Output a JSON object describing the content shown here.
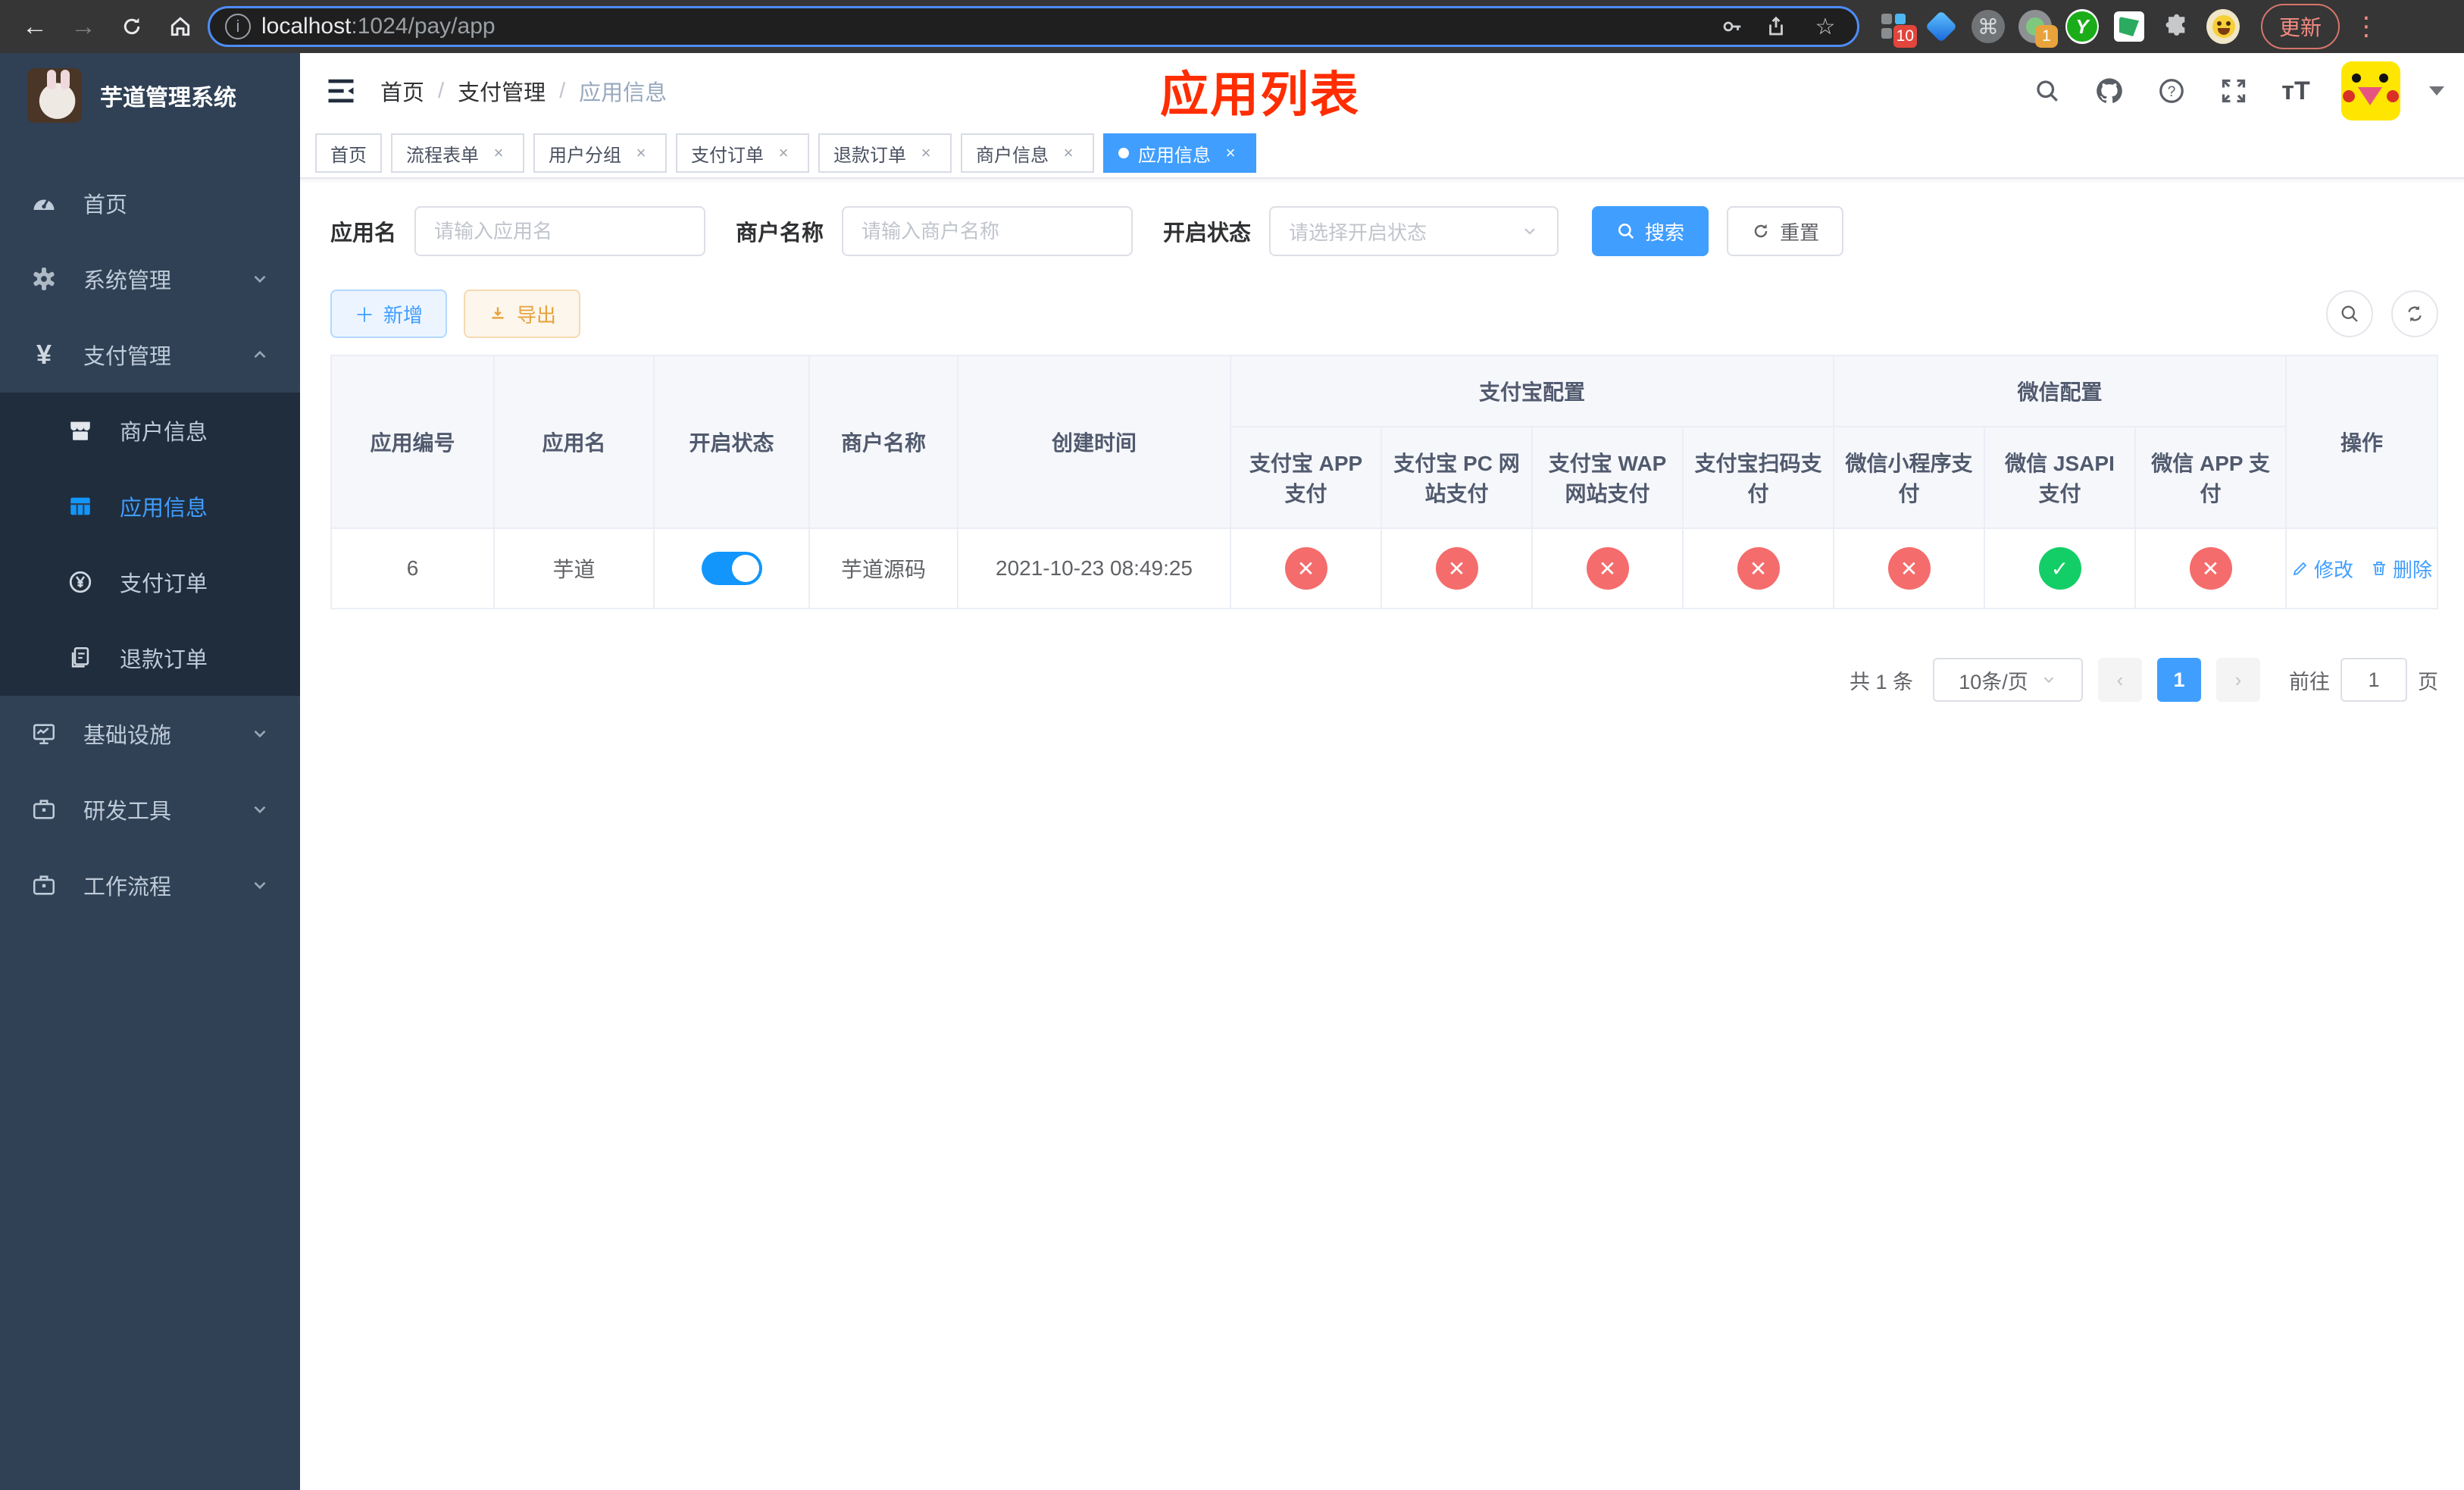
{
  "browser": {
    "url_host": "localhost",
    "url_path": ":1024/pay/app",
    "update_button": "更新",
    "ext_badge_notifications": "10",
    "ext_badge_camera": "1",
    "ext_letter": "Y"
  },
  "sidebar": {
    "title": "芋道管理系统",
    "items": [
      {
        "label": "首页"
      },
      {
        "label": "系统管理"
      },
      {
        "label": "支付管理"
      },
      {
        "label": "商户信息"
      },
      {
        "label": "应用信息"
      },
      {
        "label": "支付订单"
      },
      {
        "label": "退款订单"
      },
      {
        "label": "基础设施"
      },
      {
        "label": "研发工具"
      },
      {
        "label": "工作流程"
      }
    ]
  },
  "navbar": {
    "breadcrumb": [
      "首页",
      "支付管理",
      "应用信息"
    ],
    "banner": "应用列表"
  },
  "tabs": [
    {
      "label": "首页"
    },
    {
      "label": "流程表单"
    },
    {
      "label": "用户分组"
    },
    {
      "label": "支付订单"
    },
    {
      "label": "退款订单"
    },
    {
      "label": "商户信息"
    },
    {
      "label": "应用信息"
    }
  ],
  "filters": {
    "app_name_label": "应用名",
    "app_name_placeholder": "请输入应用名",
    "merchant_label": "商户名称",
    "merchant_placeholder": "请输入商户名称",
    "status_label": "开启状态",
    "status_placeholder": "请选择开启状态",
    "search_button": "搜索",
    "reset_button": "重置"
  },
  "toolbar": {
    "add_button": "新增",
    "export_button": "导出"
  },
  "table": {
    "headers": [
      "应用编号",
      "应用名",
      "开启状态",
      "商户名称",
      "创建时间"
    ],
    "groups": [
      {
        "label": "支付宝配置",
        "children": [
          "支付宝 APP 支付",
          "支付宝 PC 网站支付",
          "支付宝 WAP 网站支付",
          "支付宝扫码支付"
        ]
      },
      {
        "label": "微信配置",
        "children": [
          "微信小程序支付",
          "微信 JSAPI 支付",
          "微信 APP 支付"
        ]
      }
    ],
    "op_header": "操作",
    "row": {
      "id": "6",
      "name": "芋道",
      "status_on": true,
      "merchant": "芋道源码",
      "created": "2021-10-23 08:49:25",
      "configs": [
        "fail",
        "fail",
        "fail",
        "fail",
        "fail",
        "success",
        "fail"
      ],
      "edit_label": "修改",
      "delete_label": "删除"
    }
  },
  "pagination": {
    "total_text": "共 1 条",
    "page_size": "10条/页",
    "current_page": "1",
    "goto_label": "前往",
    "goto_value": "1",
    "page_unit": "页"
  },
  "colors": {
    "primary": "#409eff",
    "success": "#13ce66",
    "danger": "#f56c6c",
    "banner_red": "#ff2d00",
    "sidebar_bg": "#304156",
    "submenu_bg": "#1f2d3d"
  }
}
